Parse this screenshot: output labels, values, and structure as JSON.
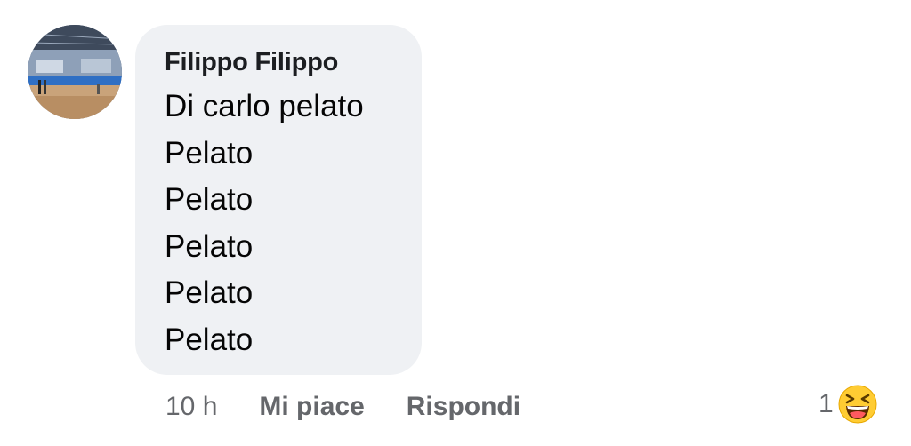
{
  "comment": {
    "author": "Filippo Filippo",
    "lines": [
      "Di carlo pelato",
      "Pelato",
      "Pelato",
      "Pelato",
      "Pelato",
      "Pelato"
    ],
    "time": "10 h",
    "like_label": "Mi piace",
    "reply_label": "Rispondi",
    "reaction_count": "1",
    "reaction_icon": "laughing-face-icon"
  },
  "colors": {
    "bubble": "#eff1f4",
    "secondary_text": "#65676b",
    "primary_text": "#050505",
    "emoji_yellow": "#ffcc33"
  }
}
